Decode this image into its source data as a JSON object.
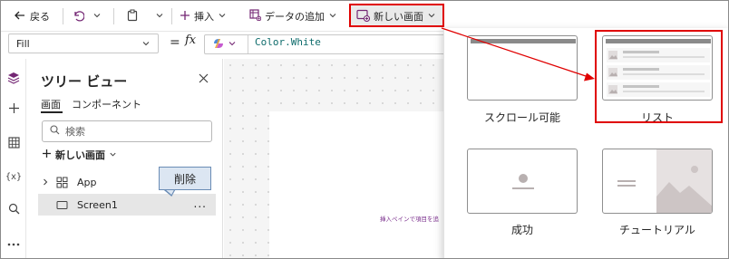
{
  "toolbar": {
    "back_label": "戻る",
    "insert_label": "挿入",
    "add_data_label": "データの追加",
    "new_screen_label": "新しい画面"
  },
  "formula_bar": {
    "property": "Fill",
    "equals": "=",
    "fx": "fx",
    "formula": "Color.White"
  },
  "tree_view": {
    "title": "ツリー ビュー",
    "tabs": [
      {
        "label": "画面",
        "active": true
      },
      {
        "label": "コンポーネント",
        "active": false
      }
    ],
    "search_placeholder": "検索",
    "new_screen_label": "新しい画面",
    "items": [
      {
        "label": "App",
        "icon": "app-icon"
      },
      {
        "label": "Screen1",
        "icon": "screen-icon",
        "selected": true
      }
    ],
    "more_label": "...",
    "delete_tooltip": "削除"
  },
  "canvas": {
    "hint": "挿入ペインで項目を追"
  },
  "new_screen_panel": {
    "layouts": [
      {
        "label": "スクロール可能",
        "icon": "scrollable-layout-icon"
      },
      {
        "label": "リスト",
        "icon": "list-layout-icon",
        "highlighted": true
      },
      {
        "label": "成功",
        "icon": "success-layout-icon"
      },
      {
        "label": "チュートリアル",
        "icon": "tutorial-layout-icon"
      }
    ]
  },
  "colors": {
    "accent": "#742774",
    "highlight": "#e00000",
    "tooltip_bg": "#dce6f2"
  }
}
